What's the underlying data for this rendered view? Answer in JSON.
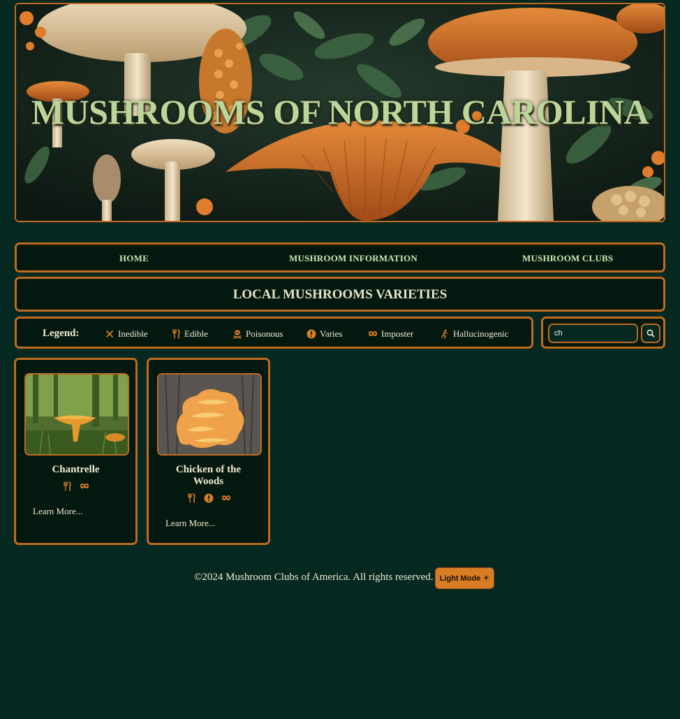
{
  "banner": {
    "title": "MUSHROOMS OF NORTH CAROLINA"
  },
  "nav": {
    "home": "HOME",
    "info": "MUSHROOM INFORMATION",
    "clubs": "MUSHROOM CLUBS"
  },
  "section": {
    "heading": "LOCAL MUSHROOMS VARIETIES"
  },
  "legend": {
    "title": "Legend:",
    "items": [
      {
        "icon": "x-icon",
        "label": "Inedible"
      },
      {
        "icon": "fork-knife-icon",
        "label": "Edible"
      },
      {
        "icon": "skull-icon",
        "label": "Poisonous"
      },
      {
        "icon": "exclamation-icon",
        "label": "Varies"
      },
      {
        "icon": "mask-icon",
        "label": "Imposter"
      },
      {
        "icon": "running-figure-icon",
        "label": "Hallucinogenic"
      }
    ]
  },
  "search": {
    "value": "ch",
    "button_icon": "search-icon"
  },
  "cards": [
    {
      "name": "Chantrelle",
      "icons": [
        "fork-knife-icon",
        "mask-icon"
      ],
      "link": "Learn More..."
    },
    {
      "name": "Chicken of the Woods",
      "icons": [
        "fork-knife-icon",
        "exclamation-icon",
        "mask-icon"
      ],
      "link": "Learn More..."
    }
  ],
  "footer": {
    "copyright": "©2024 Mushroom Clubs of America. All rights reserved.",
    "mode_button": "Light Mode ☀"
  },
  "colors": {
    "background": "#052820",
    "accent": "#c06a1f",
    "nav_text": "#cfe5ae",
    "title_green": "#bcd59a",
    "button_orange": "#d97d25"
  }
}
